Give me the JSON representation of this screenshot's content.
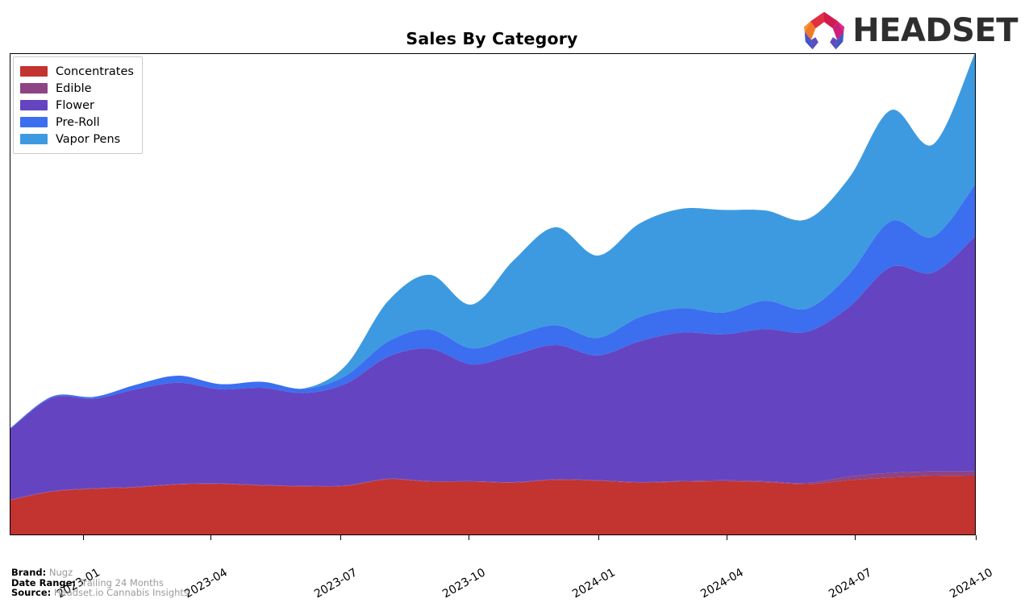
{
  "header": {
    "title": "Sales By Category",
    "logo_text": "HEADSET",
    "logo_icon": "headset-arch-logo"
  },
  "footer": {
    "rows": [
      {
        "key": "Brand:",
        "value": "Nugz"
      },
      {
        "key": "Date Range:",
        "value": "Trailing 24 Months"
      },
      {
        "key": "Source:",
        "value": "Headset.io Cannabis Insights"
      }
    ]
  },
  "chart_data": {
    "type": "area",
    "title": "Sales By Category",
    "xlabel": "",
    "ylabel": "",
    "stacked": true,
    "grid": false,
    "legend_position": "top-left",
    "axis_tick_labels": [
      "2023-01",
      "2023-04",
      "2023-07",
      "2023-10",
      "2024-01",
      "2024-04",
      "2024-07",
      "2024-10"
    ],
    "axis_tick_positions_pct": [
      7.6,
      20.8,
      34.2,
      47.5,
      60.9,
      74.2,
      87.5,
      100.0
    ],
    "x": [
      "2022-11",
      "2022-12",
      "2023-01",
      "2023-02",
      "2023-03",
      "2023-04",
      "2023-05",
      "2023-06",
      "2023-07",
      "2023-08",
      "2023-09",
      "2023-10",
      "2023-11",
      "2023-12",
      "2024-01",
      "2024-02",
      "2024-03",
      "2024-04",
      "2024-05",
      "2024-06",
      "2024-07",
      "2024-08",
      "2024-09",
      "2024-10"
    ],
    "series": [
      {
        "name": "Concentrates",
        "color": "#c33330",
        "values": [
          7.3,
          9.1,
          9.7,
          10.0,
          10.6,
          10.7,
          10.4,
          10.2,
          10.3,
          11.7,
          11.2,
          11.2,
          11.0,
          11.6,
          11.4,
          11.0,
          11.2,
          11.3,
          11.1,
          10.7,
          11.5,
          12.1,
          12.4,
          12.4
        ]
      },
      {
        "name": "Edible",
        "color": "#8e4484",
        "values": [
          0.12,
          0.12,
          0.12,
          0.12,
          0.12,
          0.12,
          0.12,
          0.12,
          0.12,
          0.12,
          0.12,
          0.12,
          0.12,
          0.12,
          0.12,
          0.12,
          0.15,
          0.2,
          0.2,
          0.25,
          0.8,
          1.0,
          1.0,
          1.0
        ]
      },
      {
        "name": "Flower",
        "color": "#6444c0",
        "values": [
          15.0,
          19.8,
          19.0,
          20.7,
          21.5,
          20.0,
          20.6,
          19.7,
          21.6,
          25.9,
          28.1,
          24.8,
          27.0,
          28.5,
          26.5,
          29.9,
          31.5,
          31.0,
          32.3,
          32.1,
          36.0,
          43.7,
          42.2,
          49.8
        ]
      },
      {
        "name": "Pre-Roll",
        "color": "#3c6ef0",
        "values": [
          0.2,
          0.3,
          0.4,
          1.0,
          1.5,
          1.1,
          1.3,
          0.9,
          1.7,
          3.2,
          4.1,
          3.4,
          4.0,
          4.2,
          3.7,
          5.1,
          5.2,
          4.6,
          6.0,
          4.9,
          6.9,
          9.7,
          7.6,
          11.0
        ]
      },
      {
        "name": "Vapor Pens",
        "color": "#3d9ae0",
        "values": [
          0.0,
          0.0,
          0.0,
          0.0,
          0.0,
          0.0,
          0.0,
          0.1,
          2.2,
          8.6,
          11.6,
          9.3,
          16.1,
          20.8,
          17.5,
          19.9,
          21.1,
          21.8,
          19.2,
          19.0,
          20.5,
          23.6,
          19.6,
          28.0
        ]
      }
    ],
    "ylim": [
      0,
      102
    ]
  },
  "legend": {
    "items": [
      {
        "label": "Concentrates",
        "color": "#c33330"
      },
      {
        "label": "Edible",
        "color": "#8e4484"
      },
      {
        "label": "Flower",
        "color": "#6444c0"
      },
      {
        "label": "Pre-Roll",
        "color": "#3c6ef0"
      },
      {
        "label": "Vapor Pens",
        "color": "#3d9ae0"
      }
    ]
  }
}
